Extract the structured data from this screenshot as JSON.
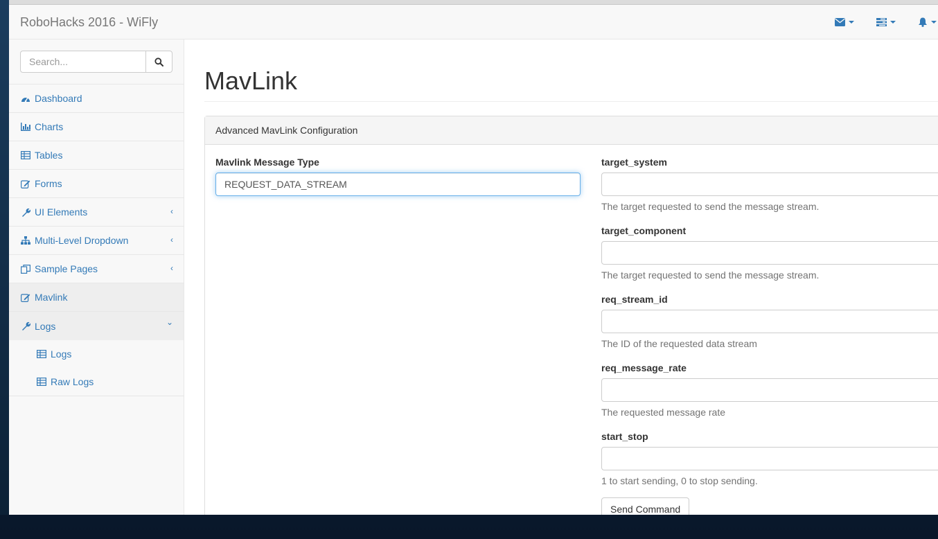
{
  "navbar": {
    "brand": "RoboHacks 2016 - WiFly",
    "icons": [
      "envelope-icon",
      "tasks-icon",
      "bell-icon"
    ]
  },
  "sidebar": {
    "search": {
      "placeholder": "Search...",
      "value": ""
    },
    "items": [
      {
        "label": "Dashboard",
        "icon": "dashboard-icon"
      },
      {
        "label": "Charts",
        "icon": "bar-chart-icon"
      },
      {
        "label": "Tables",
        "icon": "table-icon"
      },
      {
        "label": "Forms",
        "icon": "edit-icon"
      },
      {
        "label": "UI Elements",
        "icon": "wrench-icon",
        "arrow": "‹"
      },
      {
        "label": "Multi-Level Dropdown",
        "icon": "sitemap-icon",
        "arrow": "‹"
      },
      {
        "label": "Sample Pages",
        "icon": "files-icon",
        "arrow": "‹"
      },
      {
        "label": "Mavlink",
        "icon": "edit-icon"
      },
      {
        "label": "Logs",
        "icon": "wrench-icon",
        "arrow": "⌄"
      }
    ],
    "sub_items": [
      {
        "label": "Logs",
        "icon": "table-icon"
      },
      {
        "label": "Raw Logs",
        "icon": "table-icon"
      }
    ]
  },
  "main": {
    "title": "MavLink",
    "panel": {
      "heading": "Advanced MavLink Configuration",
      "message_type": {
        "label": "Mavlink Message Type",
        "value": "REQUEST_DATA_STREAM"
      },
      "fields": [
        {
          "label": "target_system",
          "value": "",
          "help": "The target requested to send the message stream."
        },
        {
          "label": "target_component",
          "value": "",
          "help": "The target requested to send the message stream."
        },
        {
          "label": "req_stream_id",
          "value": "",
          "help": "The ID of the requested data stream"
        },
        {
          "label": "req_message_rate",
          "value": "",
          "help": "The requested message rate"
        },
        {
          "label": "start_stop",
          "value": "",
          "help": "1 to start sending, 0 to stop sending."
        }
      ],
      "submit_label": "Send Command"
    }
  },
  "colors": {
    "link": "#337ab7",
    "navbar_bg": "#f8f8f8",
    "focus_border": "#66afe9"
  }
}
